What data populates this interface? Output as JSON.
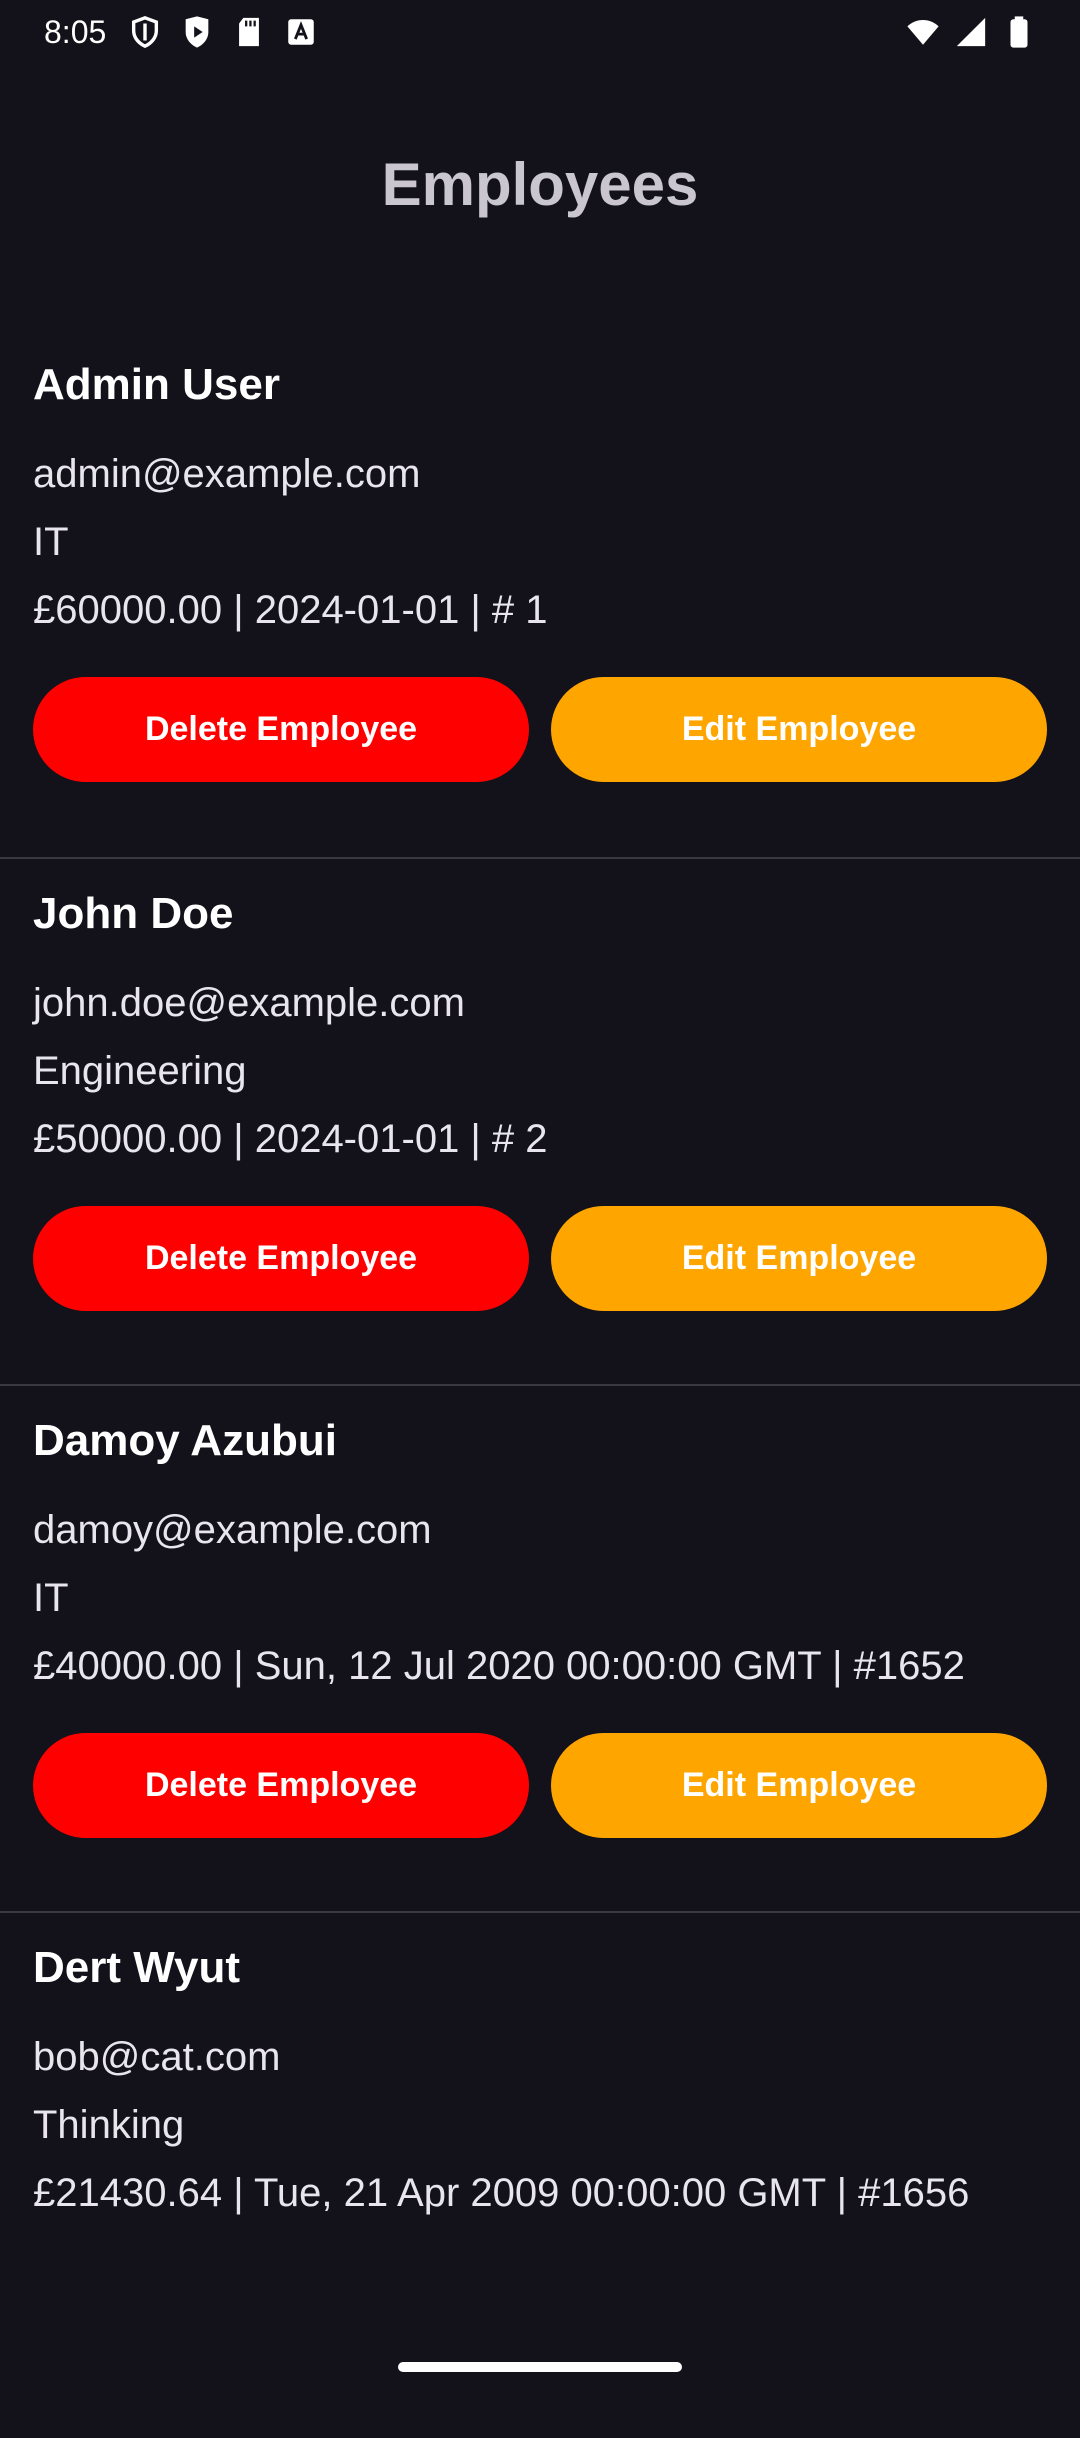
{
  "status_bar": {
    "time": "8:05",
    "left_icons": [
      "shield-icon",
      "play-store-icon",
      "sd-card-icon",
      "keyboard-a-icon"
    ],
    "right_icons": [
      "wifi-icon",
      "cell-signal-icon",
      "battery-icon"
    ]
  },
  "page": {
    "title": "Employees"
  },
  "employees": [
    {
      "name": "Admin User",
      "email": "admin@example.com",
      "department": "IT",
      "meta": "£60000.00 | 2024-01-01 | #  1",
      "delete_label": "Delete Employee",
      "edit_label": "Edit Employee"
    },
    {
      "name": "John Doe",
      "email": "john.doe@example.com",
      "department": "Engineering",
      "meta": "£50000.00 | 2024-01-01 | #  2",
      "delete_label": "Delete Employee",
      "edit_label": "Edit Employee"
    },
    {
      "name": "Damoy Azubui",
      "email": "damoy@example.com",
      "department": "IT",
      "meta": "£40000.00 | Sun, 12 Jul 2020 00:00:00 GMT | #1652",
      "delete_label": "Delete Employee",
      "edit_label": "Edit Employee"
    },
    {
      "name": "Dert Wyut",
      "email": "bob@cat.com",
      "department": "Thinking",
      "meta": "£21430.64 | Tue, 21 Apr 2009 00:00:00 GMT | #1656"
    }
  ],
  "colors": {
    "background": "#13121a",
    "delete_button": "#ff0000",
    "edit_button": "#ffa500",
    "title": "#c9c6d0"
  }
}
